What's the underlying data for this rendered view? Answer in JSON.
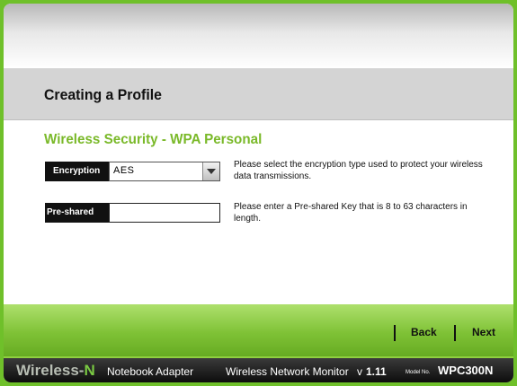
{
  "title": "Creating a Profile",
  "section_title": "Wireless Security - WPA Personal",
  "encryption": {
    "label": "Encryption",
    "selected": "AES",
    "help": "Please select the encryption type used to protect your wireless data transmissions."
  },
  "preshared": {
    "label": "Pre-shared Key",
    "value": "",
    "help": "Please enter a Pre-shared Key that is 8 to 63 characters in length."
  },
  "nav": {
    "back": "Back",
    "next": "Next"
  },
  "footer": {
    "brand": "Wireless-",
    "brand_n": "N",
    "product": "Notebook Adapter",
    "app": "Wireless Network Monitor",
    "version_prefix": "v",
    "version": "1.11",
    "model_label": "Model No.",
    "model": "WPC300N"
  },
  "colors": {
    "accent_green": "#7ab929",
    "frame_green": "#6fc02a"
  }
}
